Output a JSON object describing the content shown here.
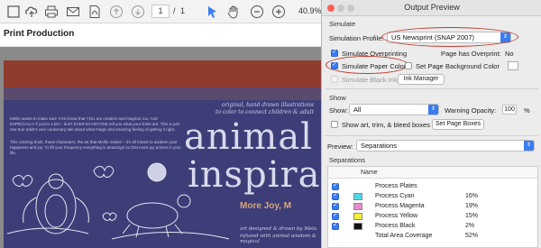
{
  "toolbar": {
    "page_current": "1",
    "page_separator": "/",
    "page_total": "1",
    "zoom": "40.9%"
  },
  "left_panel": {
    "title": "Print Production"
  },
  "document": {
    "tagline": "original, hand drawn illustrations",
    "tagline2": "to color to connect children & adult",
    "copy1": "Mellie wants to make sure YOU know that YOU are creative and magical, too. And ESPECIALLY if you're a kid – don't EVER let ANYONE tell you what your limits are. This is just one true adult's own cautionary tale about what magic and amazing feeling of getting it right...",
    "copy2": "This coloring book, these characters, the art that Mellie makes – it's all meant to awaken your happiness and joy. To lift your frequency everything is amazing!! so that more joy arrives in your life.",
    "big_word1": "animal",
    "big_word2": "inspira",
    "more_joy": "More Joy, M",
    "credit1": "art designed & drawn by Mela",
    "credit2": "infused with animal wisdom & magical"
  },
  "dialog": {
    "title": "Output Preview",
    "simulate_section": "Simulate",
    "simulation_profile_label": "Simulation Profile:",
    "simulation_profile_value": "US Newsprint (SNAP 2007)",
    "simulate_overprinting": "Simulate Overprinting",
    "page_has_overprint_label": "Page has Overprint:",
    "page_has_overprint_value": "No",
    "simulate_paper_color": "Simulate Paper Color",
    "set_page_bg_color": "Set Page Background Color",
    "simulate_black_ink": "Simulate Black Ink",
    "ink_manager": "Ink Manager",
    "show_section": "Show",
    "show_label": "Show:",
    "show_value": "All",
    "warning_opacity_label": "Warning Opacity:",
    "warning_opacity_value": "100",
    "warning_opacity_unit": "%",
    "show_art_trim_bleed": "Show art, trim, & bleed boxes",
    "set_page_boxes": "Set Page Boxes",
    "preview_label": "Preview:",
    "preview_value": "Separations",
    "separations_section": "Separations",
    "table_header_name": "Name",
    "separations": [
      {
        "name": "Process Plates",
        "pct": "",
        "color": "",
        "checked": true
      },
      {
        "name": "Process Cyan",
        "pct": "16%",
        "color": "#4fd7e8",
        "checked": true
      },
      {
        "name": "Process Magenta",
        "pct": "19%",
        "color": "#e88bd0",
        "checked": true
      },
      {
        "name": "Process Yellow",
        "pct": "15%",
        "color": "#f5f03a",
        "checked": true
      },
      {
        "name": "Process Black",
        "pct": "2%",
        "color": "#111111",
        "checked": true
      },
      {
        "name": "Total Area Coverage",
        "pct": "52%",
        "color": "",
        "checked": false
      }
    ]
  },
  "colors": {
    "accent": "#3a7cf2",
    "highlight_annotation": "#c0392b",
    "doc_bg": "#3d3e78"
  },
  "icons": [
    "upload-icon",
    "print-icon",
    "mail-icon",
    "pdf-icon",
    "page-up-icon",
    "page-down-icon",
    "select-arrow-icon",
    "hand-icon",
    "zoom-out-icon",
    "zoom-in-icon"
  ]
}
